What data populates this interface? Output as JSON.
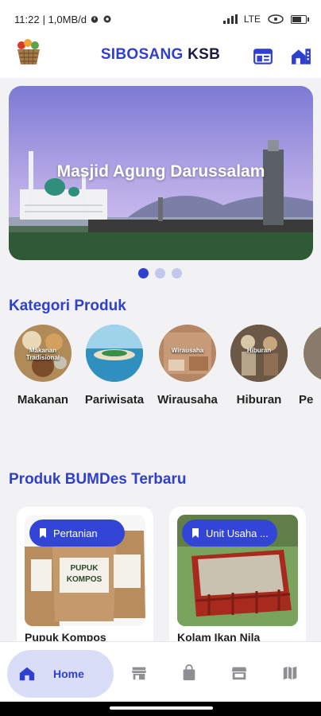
{
  "status_bar": {
    "time": "11:22",
    "info": "| 1,0MB/d",
    "network": "LTE"
  },
  "app_bar": {
    "title_part1": "SIBOSANG",
    "title_part2": "KSB"
  },
  "banner": {
    "caption": "Masjid Agung Darussalam",
    "page_count": 3,
    "active_page": 1
  },
  "kategori": {
    "title": "Kategori Produk",
    "items": [
      {
        "label": "Makanan",
        "image_caption": "Makanan Tradisional"
      },
      {
        "label": "Pariwisata",
        "image_caption": ""
      },
      {
        "label": "Wirausaha",
        "image_caption": "Wirausaha"
      },
      {
        "label": "Hiburan",
        "image_caption": "Hiburan"
      },
      {
        "label": "Pe",
        "image_caption": ""
      }
    ]
  },
  "produk": {
    "title": "Produk BUMDes Terbaru",
    "items": [
      {
        "chip": "Pertanian",
        "name": "Pupuk Kompos",
        "image_text": "PUPUK KOMPOS"
      },
      {
        "chip": "Unit Usaha ...",
        "name": "Kolam Ikan Nila"
      }
    ]
  },
  "bottom_nav": {
    "active_label": "Home",
    "items": [
      "home-icon",
      "store-icon",
      "shopping-bag-icon",
      "storefront-icon",
      "map-icon"
    ]
  },
  "colors": {
    "primary": "#2f3fcf",
    "chip": "#3345d6",
    "nav_active_bg": "#d9ddf7"
  }
}
